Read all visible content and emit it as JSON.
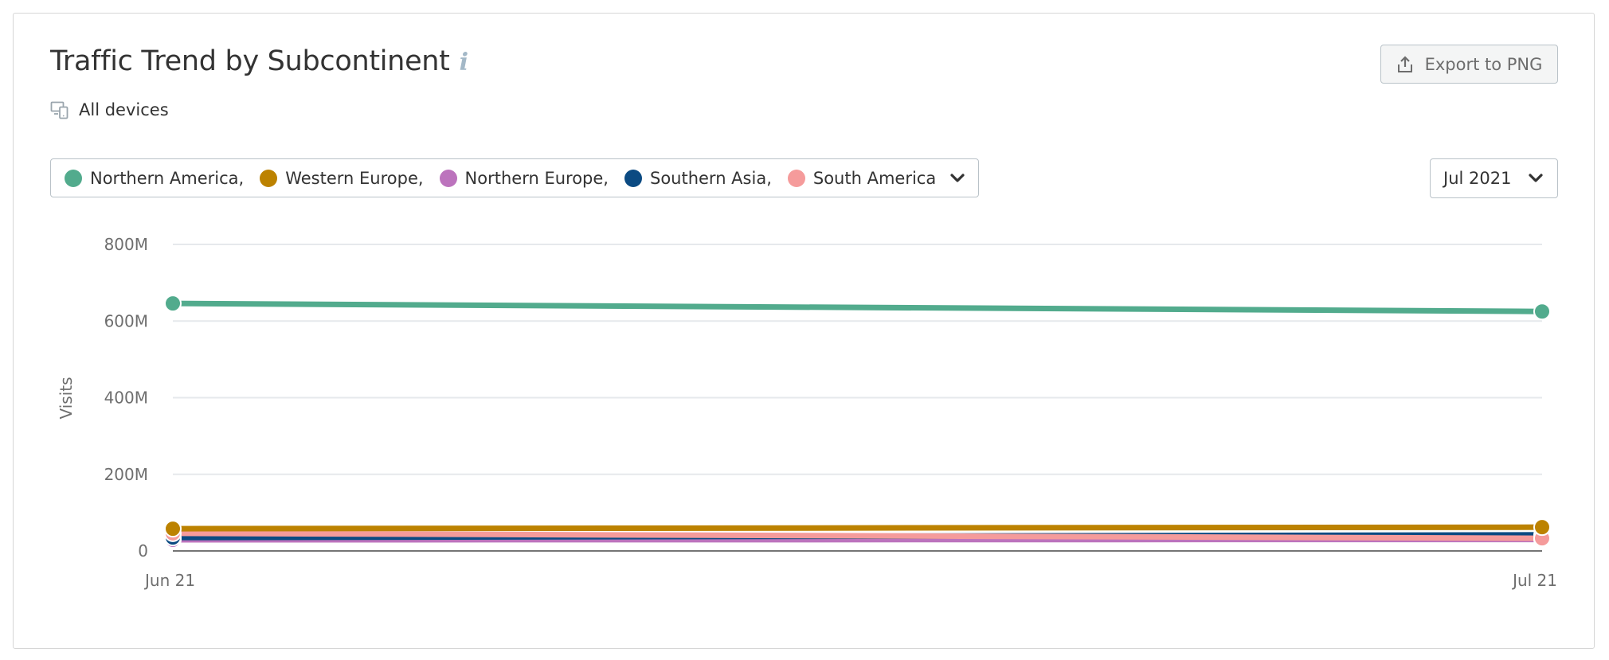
{
  "header": {
    "title": "Traffic Trend by Subcontinent",
    "info_icon": "info-icon",
    "device_filter": "All devices",
    "device_icon": "devices-icon",
    "export_label": "Export to PNG",
    "export_icon": "upload-icon"
  },
  "legend": {
    "items": [
      {
        "label": "Northern America,",
        "color": "#52ab8d"
      },
      {
        "label": "Western Europe,",
        "color": "#bc8200"
      },
      {
        "label": "Northern Europe,",
        "color": "#bc73bd"
      },
      {
        "label": "Southern Asia,",
        "color": "#0b4a82"
      },
      {
        "label": "South America",
        "color": "#f59b9b"
      }
    ],
    "toggle_icon": "chevron-down-icon"
  },
  "date_selector": {
    "value": "Jul 2021",
    "icon": "chevron-down-icon"
  },
  "chart_data": {
    "type": "line",
    "title": "Traffic Trend by Subcontinent",
    "xlabel": "",
    "ylabel": "Visits",
    "x": [
      "Jun 21",
      "Jul 21"
    ],
    "ylim": [
      0,
      800000000
    ],
    "yticks": [
      0,
      200000000,
      400000000,
      600000000,
      800000000
    ],
    "ytick_labels": [
      "0",
      "200M",
      "400M",
      "600M",
      "800M"
    ],
    "grid": true,
    "legend_position": "top-left",
    "series": [
      {
        "name": "Northern America",
        "color": "#52ab8d",
        "values": [
          646000000,
          625000000
        ]
      },
      {
        "name": "Western Europe",
        "color": "#bc8200",
        "values": [
          58000000,
          62000000
        ]
      },
      {
        "name": "Northern Europe",
        "color": "#bc73bd",
        "values": [
          29000000,
          30000000
        ]
      },
      {
        "name": "Southern Asia",
        "color": "#0b4a82",
        "values": [
          35000000,
          42000000
        ]
      },
      {
        "name": "South America",
        "color": "#f59b9b",
        "values": [
          46000000,
          33000000
        ]
      }
    ]
  }
}
